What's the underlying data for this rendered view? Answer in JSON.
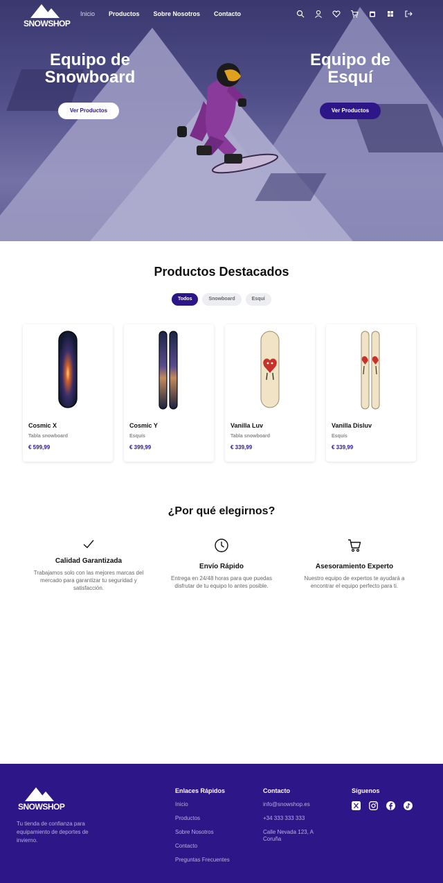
{
  "nav": {
    "logo": "SNOWSHOP",
    "items": [
      "Inicio",
      "Productos",
      "Sobre Nosotros",
      "Contacto"
    ],
    "active": "Inicio",
    "icons": [
      "search-icon",
      "user-icon",
      "heart-icon",
      "cart-icon",
      "calendar-icon",
      "grid-icon",
      "logout-icon"
    ]
  },
  "hero": {
    "left_title": "Equipo de Snowboard",
    "right_title": "Equipo de Esquí",
    "left_button": "Ver Productos",
    "right_button": "Ver Productos"
  },
  "featured": {
    "title": "Productos Destacados",
    "filters": [
      "Todos",
      "Snowboard",
      "Esquí"
    ],
    "active_filter": "Todos",
    "products": [
      {
        "name": "Cosmic X",
        "category": "Tabla snowboard",
        "price": "€ 599,99",
        "image": "cosmic-snowboard"
      },
      {
        "name": "Cosmic Y",
        "category": "Esquís",
        "price": "€ 399,99",
        "image": "cosmic-skis"
      },
      {
        "name": "Vanilla Luv",
        "category": "Tabla snowboard",
        "price": "€ 339,99",
        "image": "heart-snowboard"
      },
      {
        "name": "Vanilla Disluv",
        "category": "Esquís",
        "price": "€ 339,99",
        "image": "heart-skis"
      }
    ]
  },
  "why": {
    "title": "¿Por qué elegirnos?",
    "features": [
      {
        "icon": "check-icon",
        "title": "Calidad Garantizada",
        "text": "Trabajamos solo con las mejores marcas del mercado para garantizar tu seguridad y satisfacción."
      },
      {
        "icon": "clock-icon",
        "title": "Envío Rápido",
        "text": "Entrega en 24/48 horas para que puedas disfrutar de tu equipo lo antes posible."
      },
      {
        "icon": "cart-icon",
        "title": "Asesoramiento Experto",
        "text": "Nuestro equipo de expertos te ayudará a encontrar el equipo perfecto para ti."
      }
    ]
  },
  "footer": {
    "logo": "SNOWSHOP",
    "description": "Tu tienda de confianza para equipamiento de deportes de invierno.",
    "links_title": "Enlaces Rápidos",
    "links": [
      "Inicio",
      "Productos",
      "Sobre Nosotros",
      "Contacto",
      "Preguntas Frecuentes"
    ],
    "contact_title": "Contacto",
    "contact": [
      "info@snowshop.es",
      "+34 333 333 333",
      "Calle Nevada 123, A Coruña"
    ],
    "social_title": "Síguenos",
    "social": [
      "x-icon",
      "instagram-icon",
      "facebook-icon",
      "tiktok-icon"
    ]
  },
  "colors": {
    "brand": "#2c1688",
    "text_muted": "#666666",
    "footer_link": "#b8b0e4"
  }
}
